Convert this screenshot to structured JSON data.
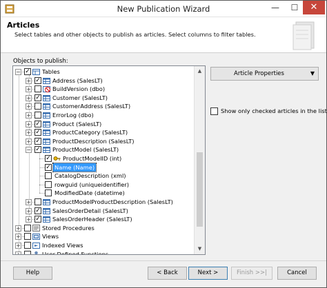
{
  "window": {
    "title": "New Publication Wizard",
    "minimize": "—",
    "maximize": "☐",
    "close": "✕"
  },
  "header": {
    "title": "Articles",
    "subtitle": "Select tables and other objects to publish as articles. Select columns to filter tables."
  },
  "objects_label": "Objects to publish:",
  "tree": [
    {
      "label": "Tables",
      "checked": true,
      "expander": "-",
      "icon": "folder-table-icon"
    },
    {
      "label": "Address (SalesLT)",
      "checked": true,
      "expander": "+",
      "icon": "table-icon"
    },
    {
      "label": "BuildVersion (dbo)",
      "checked": false,
      "expander": "+",
      "icon": "blocked-table-icon"
    },
    {
      "label": "Customer (SalesLT)",
      "checked": true,
      "expander": "+",
      "icon": "table-icon"
    },
    {
      "label": "CustomerAddress (SalesLT)",
      "checked": false,
      "expander": "+",
      "icon": "table-icon"
    },
    {
      "label": "ErrorLog (dbo)",
      "checked": false,
      "expander": "+",
      "icon": "table-icon"
    },
    {
      "label": "Product (SalesLT)",
      "checked": true,
      "expander": "+",
      "icon": "table-icon"
    },
    {
      "label": "ProductCategory (SalesLT)",
      "checked": true,
      "expander": "+",
      "icon": "table-icon"
    },
    {
      "label": "ProductDescription (SalesLT)",
      "checked": true,
      "expander": "+",
      "icon": "table-icon"
    },
    {
      "label": "ProductModel (SalesLT)",
      "checked": true,
      "expander": "-",
      "icon": "table-icon"
    },
    {
      "label": "ProductModelID (int)",
      "checked": true,
      "expander": "",
      "icon": "key-column-icon"
    },
    {
      "label": "Name (Name)",
      "checked": true,
      "expander": "",
      "icon": "",
      "selected": true
    },
    {
      "label": "CatalogDescription (xml)",
      "checked": false,
      "expander": "",
      "icon": ""
    },
    {
      "label": "rowguid (uniqueidentifier)",
      "checked": false,
      "expander": "",
      "icon": ""
    },
    {
      "label": "ModifiedDate (datetime)",
      "checked": false,
      "expander": "",
      "icon": ""
    },
    {
      "label": "ProductModelProductDescription (SalesLT)",
      "checked": false,
      "expander": "+",
      "icon": "table-icon"
    },
    {
      "label": "SalesOrderDetail (SalesLT)",
      "checked": true,
      "expander": "+",
      "icon": "table-icon"
    },
    {
      "label": "SalesOrderHeader (SalesLT)",
      "checked": true,
      "expander": "+",
      "icon": "table-icon"
    },
    {
      "label": "Stored Procedures",
      "checked": false,
      "expander": "+",
      "icon": "procedure-icon"
    },
    {
      "label": "Views",
      "checked": false,
      "expander": "+",
      "icon": "view-icon"
    },
    {
      "label": "Indexed Views",
      "checked": false,
      "expander": "+",
      "icon": "indexed-view-icon"
    },
    {
      "label": "User Defined Functions",
      "checked": false,
      "expander": "+",
      "icon": "function-icon"
    }
  ],
  "article_properties": {
    "label": "Article Properties",
    "dropdown": "▼"
  },
  "show_only_checked": {
    "label": "Show only checked articles in the list",
    "checked": false
  },
  "buttons": {
    "help": "Help",
    "back": "< Back",
    "next": "Next >",
    "finish": "Finish >>|",
    "cancel": "Cancel"
  },
  "colors": {
    "selection": "#3399ff",
    "close_button": "#c7463b",
    "table_icon": "#3a6fb0"
  }
}
